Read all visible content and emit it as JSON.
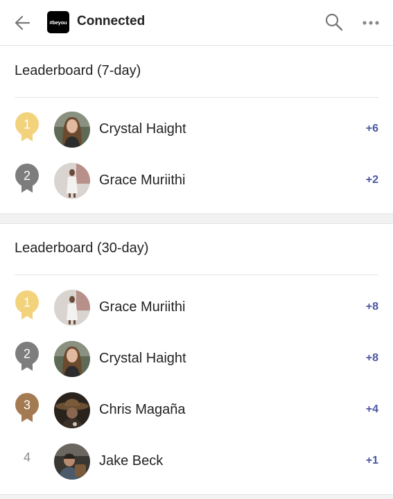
{
  "header": {
    "back_icon": "arrow-left-icon",
    "app_logo_text": "#beyou",
    "title": "Connected",
    "search_icon": "search-icon",
    "more_icon": "more-horizontal-icon"
  },
  "leaderboard_7day": {
    "title": "Leaderboard (7-day)",
    "entries": [
      {
        "rank": "1",
        "medal": "gold",
        "name": "Crystal Haight",
        "score": "+6"
      },
      {
        "rank": "2",
        "medal": "silver",
        "name": "Grace Muriithi",
        "score": "+2"
      }
    ]
  },
  "leaderboard_30day": {
    "title": "Leaderboard (30-day)",
    "entries": [
      {
        "rank": "1",
        "medal": "gold",
        "name": "Grace Muriithi",
        "score": "+8"
      },
      {
        "rank": "2",
        "medal": "silver",
        "name": "Crystal Haight",
        "score": "+8"
      },
      {
        "rank": "3",
        "medal": "bronze",
        "name": "Chris Magaña",
        "score": "+4"
      },
      {
        "rank": "4",
        "medal": "none",
        "name": "Jake Beck",
        "score": "+1"
      }
    ]
  },
  "colors": {
    "gold": "#f3d27c",
    "silver": "#7d7d7d",
    "bronze": "#a37a52",
    "score": "#4a56a0"
  }
}
